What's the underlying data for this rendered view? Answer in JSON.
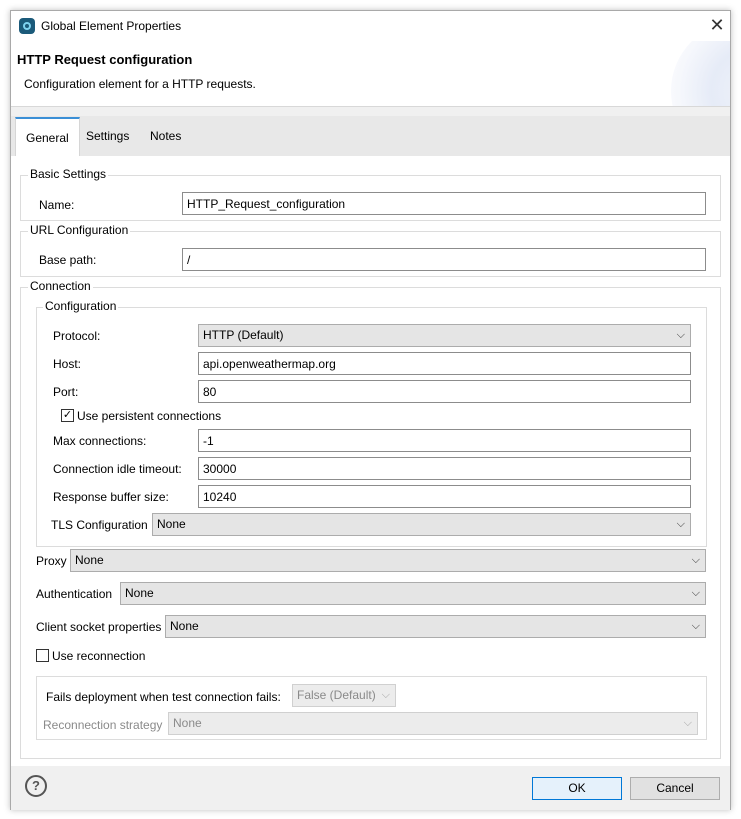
{
  "window": {
    "title": "Global Element Properties",
    "close_icon": "close-icon",
    "app_icon": "app-icon"
  },
  "header": {
    "title": "HTTP Request configuration",
    "description": "Configuration element for a HTTP requests."
  },
  "tabs": [
    {
      "label": "General",
      "active": true
    },
    {
      "label": "Settings",
      "active": false
    },
    {
      "label": "Notes",
      "active": false
    }
  ],
  "basic_settings": {
    "group_label": "Basic Settings",
    "name_label": "Name:",
    "name_value": "HTTP_Request_configuration"
  },
  "url_configuration": {
    "group_label": "URL Configuration",
    "base_path_label": "Base path:",
    "base_path_value": "/"
  },
  "connection": {
    "group_label": "Connection",
    "configuration": {
      "group_label": "Configuration",
      "protocol_label": "Protocol:",
      "protocol_value": "HTTP (Default)",
      "host_label": "Host:",
      "host_value": "api.openweathermap.org",
      "port_label": "Port:",
      "port_value": "80",
      "persistent_label": "Use persistent connections",
      "persistent_checked": true,
      "persistent_mark": "✓",
      "max_connections_label": "Max connections:",
      "max_connections_value": "-1",
      "idle_timeout_label": "Connection idle timeout:",
      "idle_timeout_value": "30000",
      "buffer_size_label": "Response buffer size:",
      "buffer_size_value": "10240",
      "tls_label": "TLS Configuration",
      "tls_value": "None"
    },
    "proxy_label": "Proxy",
    "proxy_value": "None",
    "authentication_label": "Authentication",
    "authentication_value": "None",
    "client_socket_label": "Client socket properties",
    "client_socket_value": "None",
    "reconnection_label": "Use reconnection",
    "reconnection_checked": false,
    "fails_deployment_label": "Fails deployment when test connection fails:",
    "fails_deployment_value": "False (Default)",
    "reconnection_strategy_label": "Reconnection strategy",
    "reconnection_strategy_value": "None"
  },
  "footer": {
    "help_icon": "help-icon",
    "help_glyph": "?",
    "ok_label": "OK",
    "cancel_label": "Cancel"
  },
  "colors": {
    "tab_accent": "#3b8fd6",
    "primary_button_border": "#0078d7",
    "window_background": "#f0f0f0"
  },
  "glyphs": {
    "chevron": "⌵",
    "close": "✕"
  }
}
